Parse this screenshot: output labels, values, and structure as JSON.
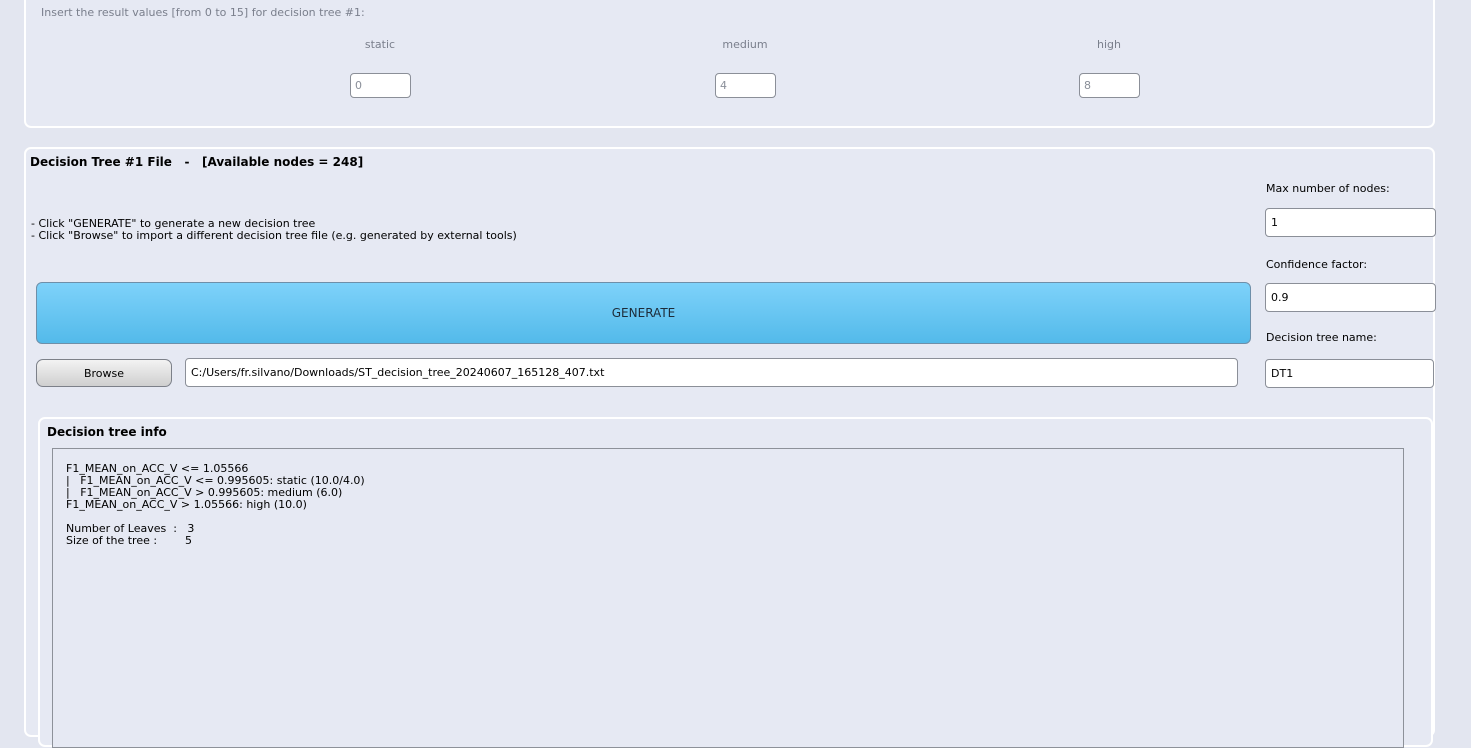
{
  "results": {
    "hint": "Insert the result values [from 0 to 15] for decision tree #1:",
    "columns": [
      {
        "label": "static",
        "value": "0"
      },
      {
        "label": "medium",
        "value": "4"
      },
      {
        "label": "high",
        "value": "8"
      }
    ]
  },
  "tree_panel": {
    "title": "Decision Tree #1 File   -   [Available nodes = 248]",
    "instructions": [
      "- Click \"GENERATE\" to generate a new decision tree",
      "- Click \"Browse\" to import a different decision tree file (e.g. generated by external tools)"
    ],
    "generate_label": "GENERATE",
    "browse_label": "Browse",
    "file_path": "C:/Users/fr.silvano/Downloads/ST_decision_tree_20240607_165128_407.txt",
    "max_nodes_label": "Max number of nodes:",
    "max_nodes_value": "1",
    "confidence_label": "Confidence factor:",
    "confidence_value": "0.9",
    "tree_name_label": "Decision tree name:",
    "tree_name_value": "DT1"
  },
  "info": {
    "title": "Decision tree info",
    "text": "F1_MEAN_on_ACC_V <= 1.05566\n|   F1_MEAN_on_ACC_V <= 0.995605: static (10.0/4.0)\n|   F1_MEAN_on_ACC_V > 0.995605: medium (6.0)\nF1_MEAN_on_ACC_V > 1.05566: high (10.0)\n\nNumber of Leaves  :   3\nSize of the tree :        5"
  }
}
